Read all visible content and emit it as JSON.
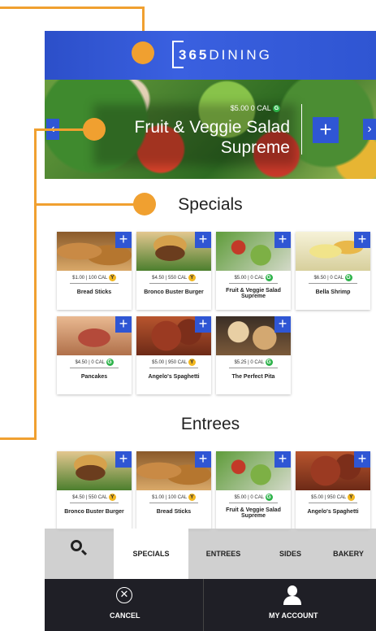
{
  "brand": {
    "logo_strong": "365",
    "logo_light": "DINING"
  },
  "hero": {
    "price": "$5.00",
    "calories": "0 CAL",
    "badge": "G",
    "title_line1": "Fruit & Veggie Salad",
    "title_line2": "Supreme",
    "add_label": "+",
    "prev_label": "‹",
    "next_label": "›"
  },
  "sections": {
    "specials_title": "Specials",
    "entrees_title": "Entrees"
  },
  "specials": [
    {
      "name": "Bread Sticks",
      "price": "$1.00",
      "cal": "100 CAL",
      "badge": "Y"
    },
    {
      "name": "Bronco Buster Burger",
      "price": "$4.50",
      "cal": "550 CAL",
      "badge": "Y"
    },
    {
      "name": "Fruit & Veggie Salad Supreme",
      "price": "$5.00",
      "cal": "0 CAL",
      "badge": "G"
    },
    {
      "name": "Bella Shrimp",
      "price": "$6.50",
      "cal": "0 CAL",
      "badge": "G"
    },
    {
      "name": "Pancakes",
      "price": "$4.50",
      "cal": "0 CAL",
      "badge": "G"
    },
    {
      "name": "Angelo's Spaghetti",
      "price": "$5.00",
      "cal": "950 CAL",
      "badge": "Y"
    },
    {
      "name": "The Perfect Pita",
      "price": "$5.25",
      "cal": "0 CAL",
      "badge": "G"
    }
  ],
  "entrees": [
    {
      "name": "Bronco Buster Burger",
      "price": "$4.50",
      "cal": "550 CAL",
      "badge": "Y"
    },
    {
      "name": "Bread Sticks",
      "price": "$1.00",
      "cal": "100 CAL",
      "badge": "Y"
    },
    {
      "name": "Fruit & Veggie Salad Supreme",
      "price": "$5.00",
      "cal": "0 CAL",
      "badge": "G"
    },
    {
      "name": "Angelo's Spaghetti",
      "price": "$5.00",
      "cal": "950 CAL",
      "badge": "Y"
    }
  ],
  "card_add_label": "+",
  "tabs": {
    "search": "SEARCH",
    "specials": "SPECIALS",
    "entrees": "ENTREES",
    "sides": "SIDES",
    "bakery": "BAKERY"
  },
  "bottom": {
    "cancel": "CANCEL",
    "account": "MY ACCOUNT",
    "cancel_glyph": "✕"
  },
  "colors": {
    "brand_blue": "#2f56d4",
    "callout": "#f0a030",
    "bar": "#1f1f26",
    "green_badge": "#2db34a",
    "yellow_badge": "#f2b61e"
  }
}
